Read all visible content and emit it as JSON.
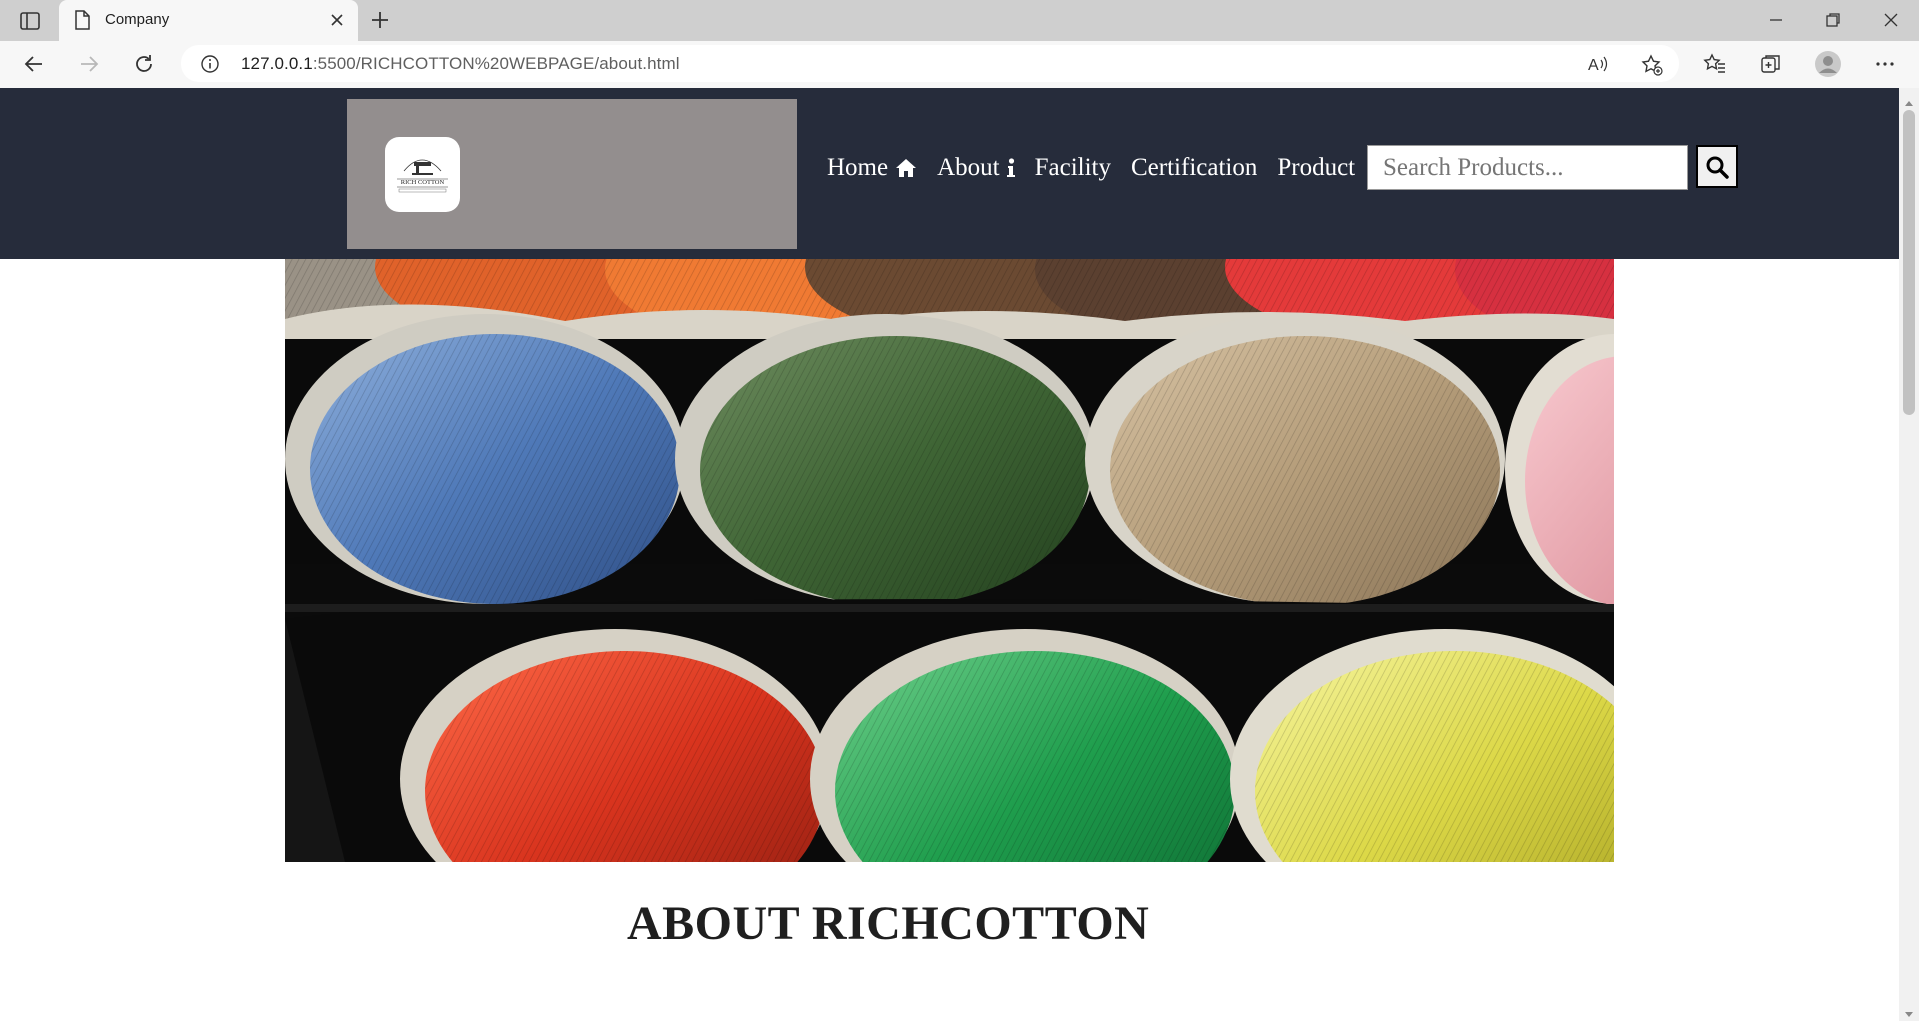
{
  "browser": {
    "tab_title": "Company",
    "url_host": "127.0.0.1",
    "url_path": ":5500/RICHCOTTON%20WEBPAGE/about.html"
  },
  "nav": {
    "links": [
      {
        "label": "Home",
        "icon": "home-icon"
      },
      {
        "label": "About",
        "icon": "info-icon"
      },
      {
        "label": "Facility"
      },
      {
        "label": "Certification"
      },
      {
        "label": "Product"
      }
    ],
    "search_placeholder": "Search Products...",
    "search_icon": "search-icon"
  },
  "logo": {
    "brand": "RICH COTTON"
  },
  "hero": {
    "image": "colorful-thread-spools"
  },
  "main": {
    "title": "ABOUT RICHCOTTON"
  },
  "colors": {
    "navbar_bg": "#262c3b",
    "logo_bg": "#938e8e",
    "title_text": "#1f1f1f"
  }
}
